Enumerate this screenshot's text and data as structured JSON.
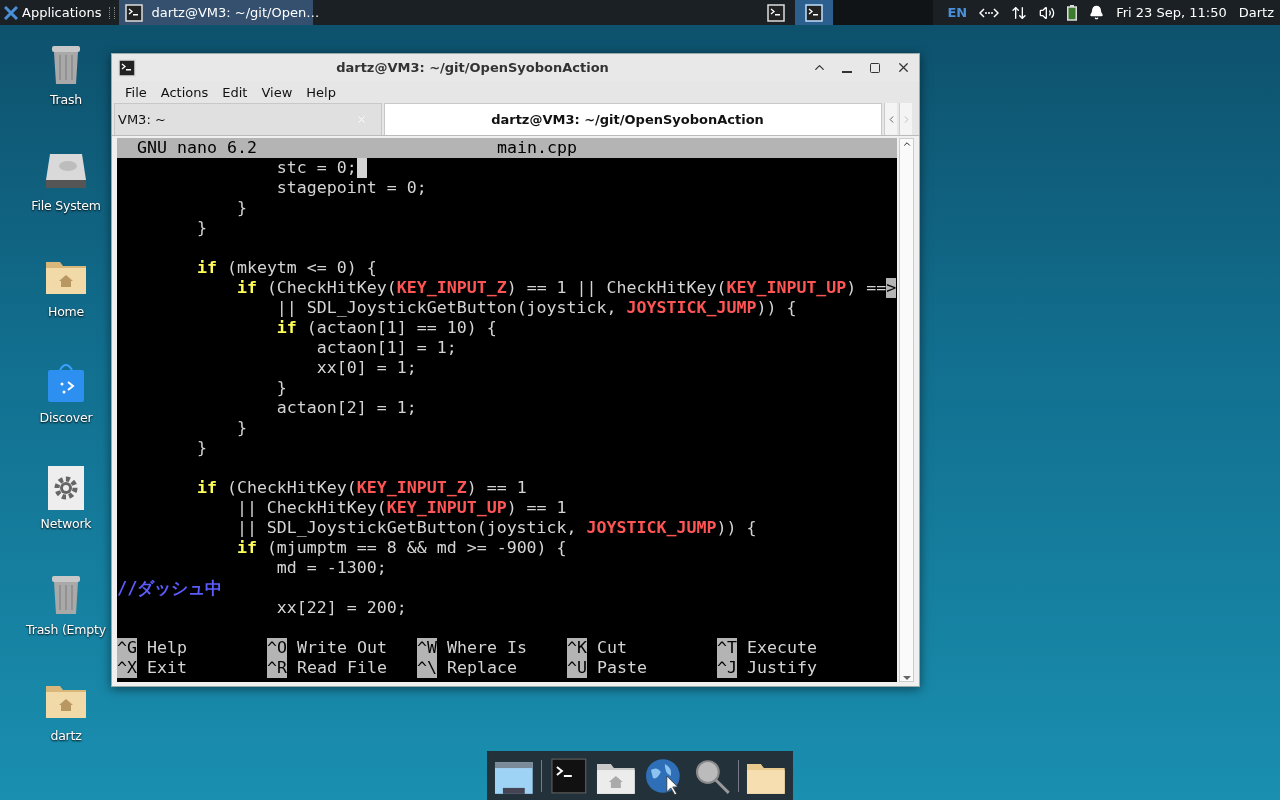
{
  "top_panel": {
    "apps_menu": "Applications",
    "tasks": [
      {
        "title": "dartz@VM3: ~/git/Open…",
        "selected": true
      }
    ],
    "workspaces": [
      {
        "selected": false
      },
      {
        "selected": true
      }
    ],
    "keyboard": "EN",
    "clock": "Fri 23 Sep, 11:50",
    "user": "Dartz"
  },
  "desktop_icons": [
    {
      "label": "Trash",
      "kind": "trash"
    },
    {
      "label": "File System",
      "kind": "drive"
    },
    {
      "label": "Home",
      "kind": "home-folder"
    },
    {
      "label": "Discover",
      "kind": "store"
    },
    {
      "label": "Network",
      "kind": "settings"
    },
    {
      "label": "Trash (Empty",
      "kind": "trash"
    },
    {
      "label": "dartz",
      "kind": "home-folder"
    }
  ],
  "window": {
    "title": "dartz@VM3: ~/git/OpenSyobonAction",
    "menu": [
      "File",
      "Actions",
      "Edit",
      "View",
      "Help"
    ],
    "tabs": [
      {
        "label": "VM3: ~",
        "selected": false
      },
      {
        "label": "dartz@VM3: ~/git/OpenSyobonAction",
        "selected": true
      }
    ],
    "nano": {
      "version": "GNU nano 6.2",
      "filename": "main.cpp",
      "lines": [
        {
          "kind": "code",
          "cursor": true,
          "segs": [
            {
              "kind": "plain",
              "text": "                stc = 0;"
            }
          ]
        },
        {
          "kind": "code",
          "segs": [
            {
              "kind": "plain",
              "text": "                stagepoint = 0;"
            }
          ]
        },
        {
          "kind": "code",
          "segs": [
            {
              "kind": "plain",
              "text": "            }"
            }
          ]
        },
        {
          "kind": "code",
          "segs": [
            {
              "kind": "plain",
              "text": "        }"
            }
          ]
        },
        {
          "kind": "blank"
        },
        {
          "kind": "code",
          "segs": [
            {
              "kind": "keyword",
              "text": "        if"
            },
            {
              "kind": "plain",
              "text": " (mkeytm <= 0) {"
            }
          ]
        },
        {
          "kind": "code",
          "segs": [
            {
              "kind": "keyword",
              "text": "            if"
            },
            {
              "kind": "plain",
              "text": " (CheckHitKey("
            },
            {
              "kind": "constant",
              "text": "KEY_INPUT_Z"
            },
            {
              "kind": "plain",
              "text": ") == 1 || CheckHitKey("
            },
            {
              "kind": "constant",
              "text": "KEY_INPUT_UP"
            },
            {
              "kind": "plain",
              "text": ") =="
            },
            {
              "kind": "marker",
              "text": ">"
            }
          ]
        },
        {
          "kind": "code",
          "segs": [
            {
              "kind": "plain",
              "text": "                || SDL_JoystickGetButton(joystick, "
            },
            {
              "kind": "constant",
              "text": "JOYSTICK_JUMP"
            },
            {
              "kind": "plain",
              "text": ")) {"
            }
          ]
        },
        {
          "kind": "code",
          "segs": [
            {
              "kind": "keyword",
              "text": "                if"
            },
            {
              "kind": "plain",
              "text": " (actaon[1] == 10) {"
            }
          ]
        },
        {
          "kind": "code",
          "segs": [
            {
              "kind": "plain",
              "text": "                    actaon[1] = 1;"
            }
          ]
        },
        {
          "kind": "code",
          "segs": [
            {
              "kind": "plain",
              "text": "                    xx[0] = 1;"
            }
          ]
        },
        {
          "kind": "code",
          "segs": [
            {
              "kind": "plain",
              "text": "                }"
            }
          ]
        },
        {
          "kind": "code",
          "segs": [
            {
              "kind": "plain",
              "text": "                actaon[2] = 1;"
            }
          ]
        },
        {
          "kind": "code",
          "segs": [
            {
              "kind": "plain",
              "text": "            }"
            }
          ]
        },
        {
          "kind": "code",
          "segs": [
            {
              "kind": "plain",
              "text": "        }"
            }
          ]
        },
        {
          "kind": "blank"
        },
        {
          "kind": "code",
          "segs": [
            {
              "kind": "keyword",
              "text": "        if"
            },
            {
              "kind": "plain",
              "text": " (CheckHitKey("
            },
            {
              "kind": "constant",
              "text": "KEY_INPUT_Z"
            },
            {
              "kind": "plain",
              "text": ") == 1"
            }
          ]
        },
        {
          "kind": "code",
          "segs": [
            {
              "kind": "plain",
              "text": "            || CheckHitKey("
            },
            {
              "kind": "constant",
              "text": "KEY_INPUT_UP"
            },
            {
              "kind": "plain",
              "text": ") == 1"
            }
          ]
        },
        {
          "kind": "code",
          "segs": [
            {
              "kind": "plain",
              "text": "            || SDL_JoystickGetButton(joystick, "
            },
            {
              "kind": "constant",
              "text": "JOYSTICK_JUMP"
            },
            {
              "kind": "plain",
              "text": ")) {"
            }
          ]
        },
        {
          "kind": "code",
          "segs": [
            {
              "kind": "keyword",
              "text": "            if"
            },
            {
              "kind": "plain",
              "text": " (mjumptm == 8 && md >= -900) {"
            }
          ]
        },
        {
          "kind": "code",
          "segs": [
            {
              "kind": "plain",
              "text": "                md = -1300;"
            }
          ]
        },
        {
          "kind": "code",
          "segs": [
            {
              "kind": "comment",
              "text": "//ダッシュ中"
            }
          ]
        },
        {
          "kind": "code",
          "segs": [
            {
              "kind": "plain",
              "text": "                xx[22] = 200;"
            }
          ]
        },
        {
          "kind": "blank"
        }
      ],
      "shortcuts": [
        {
          "key": "^G",
          "label": "Help"
        },
        {
          "key": "^O",
          "label": "Write Out"
        },
        {
          "key": "^W",
          "label": "Where Is"
        },
        {
          "key": "^K",
          "label": "Cut"
        },
        {
          "key": "^T",
          "label": "Execute"
        },
        {
          "key": "^X",
          "label": "Exit"
        },
        {
          "key": "^R",
          "label": "Read File"
        },
        {
          "key": "^\\",
          "label": "Replace"
        },
        {
          "key": "^U",
          "label": "Paste"
        },
        {
          "key": "^J",
          "label": "Justify"
        }
      ]
    }
  },
  "dock": [
    {
      "kind": "screen"
    },
    {
      "kind": "terminal"
    },
    {
      "kind": "home-folder"
    },
    {
      "kind": "globe"
    },
    {
      "kind": "search"
    },
    {
      "kind": "folder"
    }
  ]
}
